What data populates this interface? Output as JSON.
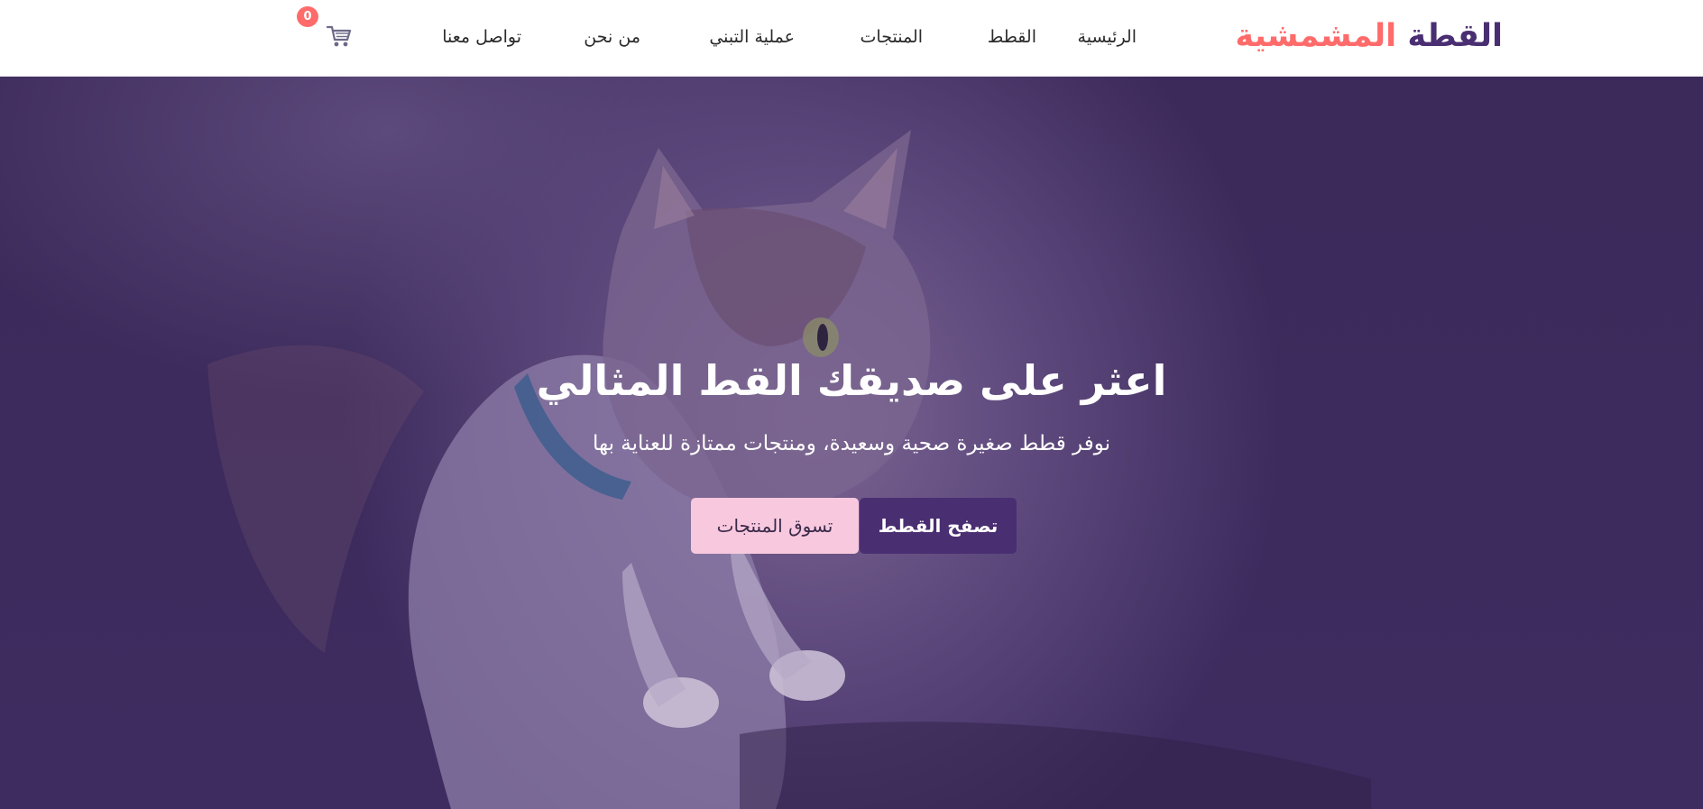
{
  "brand": {
    "part1": "القطة",
    "part2": "المشمشية"
  },
  "nav": {
    "home": "الرئيسية",
    "cats": "القطط",
    "products": "المنتجات",
    "adoption": "عملية التبني",
    "about": "من نحن",
    "contact": "تواصل معنا"
  },
  "cart": {
    "icon": "cart-icon",
    "count": "0"
  },
  "hero": {
    "title": "اعثر على صديقك القط المثالي",
    "subtitle": "نوفر قطط صغيرة صحية وسعيدة، ومنتجات ممتازة للعناية بها",
    "primary_button": "تصفح القطط",
    "secondary_button": "تسوق المنتجات"
  },
  "colors": {
    "brand_primary": "#4a2e72",
    "brand_accent": "#ff6b6b",
    "button_secondary": "#f8c8de",
    "hero_overlay": "#3d2a5c"
  }
}
